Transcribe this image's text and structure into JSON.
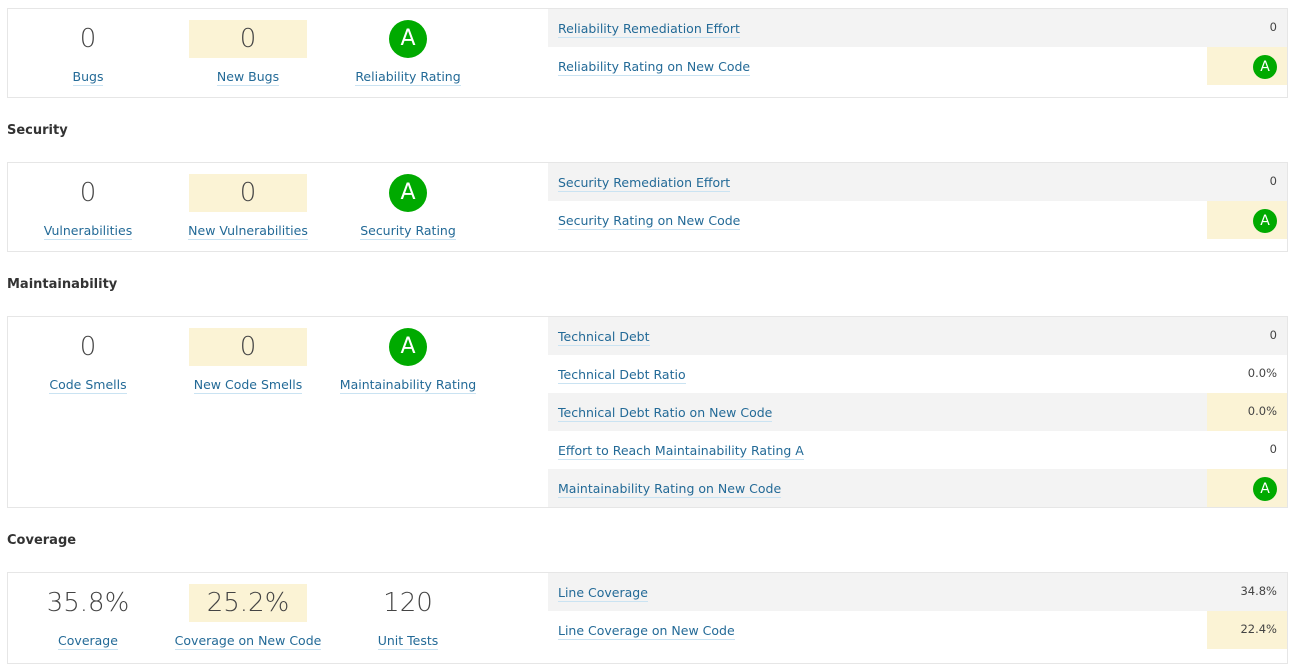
{
  "reliability": {
    "bugs_value": "0",
    "bugs_label": "Bugs",
    "new_bugs_value": "0",
    "new_bugs_label": "New Bugs",
    "rating_value": "A",
    "rating_label": "Reliability Rating",
    "rows": [
      {
        "label": "Reliability Remediation Effort",
        "value": "0"
      },
      {
        "label": "Reliability Rating on New Code",
        "value": "A"
      }
    ]
  },
  "security": {
    "title": "Security",
    "vuln_value": "0",
    "vuln_label": "Vulnerabilities",
    "new_vuln_value": "0",
    "new_vuln_label": "New Vulnerabilities",
    "rating_value": "A",
    "rating_label": "Security Rating",
    "rows": [
      {
        "label": "Security Remediation Effort",
        "value": "0"
      },
      {
        "label": "Security Rating on New Code",
        "value": "A"
      }
    ]
  },
  "maintainability": {
    "title": "Maintainability",
    "smells_value": "0",
    "smells_label": "Code Smells",
    "new_smells_value": "0",
    "new_smells_label": "New Code Smells",
    "rating_value": "A",
    "rating_label": "Maintainability Rating",
    "rows": [
      {
        "label": "Technical Debt",
        "value": "0"
      },
      {
        "label": "Technical Debt Ratio",
        "value": "0.0%"
      },
      {
        "label": "Technical Debt Ratio on New Code",
        "value": "0.0%"
      },
      {
        "label": "Effort to Reach Maintainability Rating A",
        "value": "0"
      },
      {
        "label": "Maintainability Rating on New Code",
        "value": "A"
      }
    ]
  },
  "coverage": {
    "title": "Coverage",
    "coverage_value": "35.8%",
    "coverage_label": "Coverage",
    "new_coverage_value": "25.2%",
    "new_coverage_label": "Coverage on New Code",
    "unit_tests_value": "120",
    "unit_tests_label": "Unit Tests",
    "rows": [
      {
        "label": "Line Coverage",
        "value": "34.8%"
      },
      {
        "label": "Line Coverage on New Code",
        "value": "22.4%"
      }
    ]
  },
  "colors": {
    "rating_a": "#00aa00",
    "new_code_bg": "#fbf3d5",
    "link": "#236a97"
  }
}
